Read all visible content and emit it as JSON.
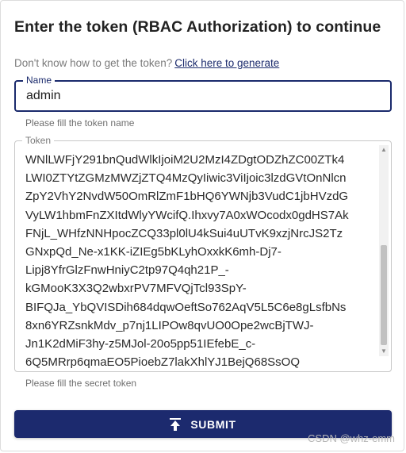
{
  "dialog": {
    "title": "Enter the token (RBAC Authorization) to continue",
    "help_text": "Don't know how to get the token?",
    "help_link": "Click here to generate"
  },
  "name_field": {
    "label": "Name",
    "value": "admin",
    "hint": "Please fill the token name"
  },
  "token_field": {
    "label": "Token",
    "lines": [
      "WNlLWFjY291bnQudWlkIjoiM2U2MzI4ZDgtODZhZC00ZTk4",
      "LWI0ZTYtZGMzMWZjZTQ4MzQyIiwic3ViIjoic3lzdGVtOnNlcn",
      "ZpY2VhY2NvdW50OmRlZmF1bHQ6YWNjb3VudC1jbHVzdG",
      "VyLW1hbmFnZXItdWlyYWcifQ.Ihxvy7A0xWOcodx0gdHS7Ak",
      "FNjL_WHfzNNHpocZCQ33pl0lU4kSui4uUTvK9xzjNrcJS2Tz",
      "GNxpQd_Ne-x1KK-iZIEg5bKLyhOxxkK6mh-Dj7-",
      "Lipj8YfrGlzFnwHniyC2tp97Q4qh21P_-",
      "kGMooK3X3Q2wbxrPV7MFVQjTcl93SpY-",
      "BIFQJa_YbQVISDih684dqwOeftSo762AqV5L5C6e8gLsfbNs",
      "8xn6YRZsnkMdv_p7nj1LIPOw8qvUO0Ope2wcBjTWJ-",
      "Jn1K2dMiF3hy-z5MJol-20o5pp51IEfebE_c-",
      "6Q5MRrp6qmaEO5PioebZ7lakXhlYJ1BejQ68SsOQ"
    ],
    "hint": "Please fill the secret token"
  },
  "submit": {
    "label": "SUBMIT",
    "icon": "upload-icon"
  },
  "watermark": "CSDN @whz-emm"
}
